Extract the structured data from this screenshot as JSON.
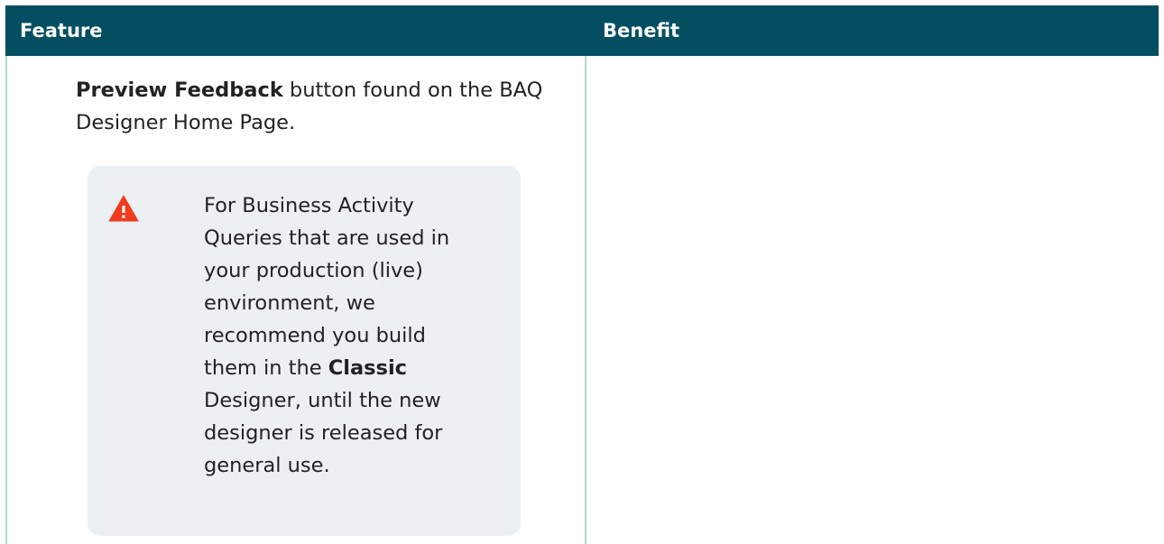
{
  "table": {
    "headers": {
      "feature": "Feature",
      "benefit": "Benefit"
    },
    "rows": [
      {
        "feature": {
          "bold_label": "Preview Feedback",
          "text_after_label": " button found on the BAQ Designer Home Page.",
          "note": {
            "icon": "warning-triangle-icon",
            "icon_color": "#f03b1f",
            "text_before_bold": "For Business Activity Queries that are used in your production (live) environment, we recommend you build them in the ",
            "bold_text": "Classic",
            "text_after_bold": " Designer, until the new designer is released for general use."
          }
        },
        "benefit": ""
      }
    ]
  },
  "colors": {
    "header_background": "#034f61",
    "header_text": "#ffffff",
    "border": "#a9dccd",
    "note_background": "#edf0f3"
  }
}
